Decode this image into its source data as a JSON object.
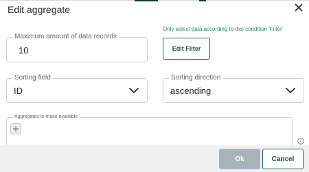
{
  "dialog": {
    "title": "Edit aggregate",
    "close_icon": "close-icon"
  },
  "max_records": {
    "label": "Maximum amount of data records",
    "value": "10"
  },
  "filter": {
    "hint": "Only select data according to this condition 'Filter'",
    "button_label": "Edit Filter"
  },
  "sorting_field": {
    "label": "Sorting field",
    "value": "ID",
    "icon": "chevron-down-icon"
  },
  "sorting_direction": {
    "label": "Sorting direction",
    "value": "ascending",
    "icon": "chevron-down-icon"
  },
  "aggregates": {
    "label": "Aggregates to make available",
    "add_icon": "plus-icon",
    "info_icon": "info-icon"
  },
  "footer": {
    "ok_label": "Ok",
    "cancel_label": "Cancel"
  },
  "colors": {
    "accent": "#1e5f4b",
    "hint_text": "#1f8a62",
    "ok_button_disabled": "#a7b3bb",
    "footer_background": "#f0f0f0"
  }
}
